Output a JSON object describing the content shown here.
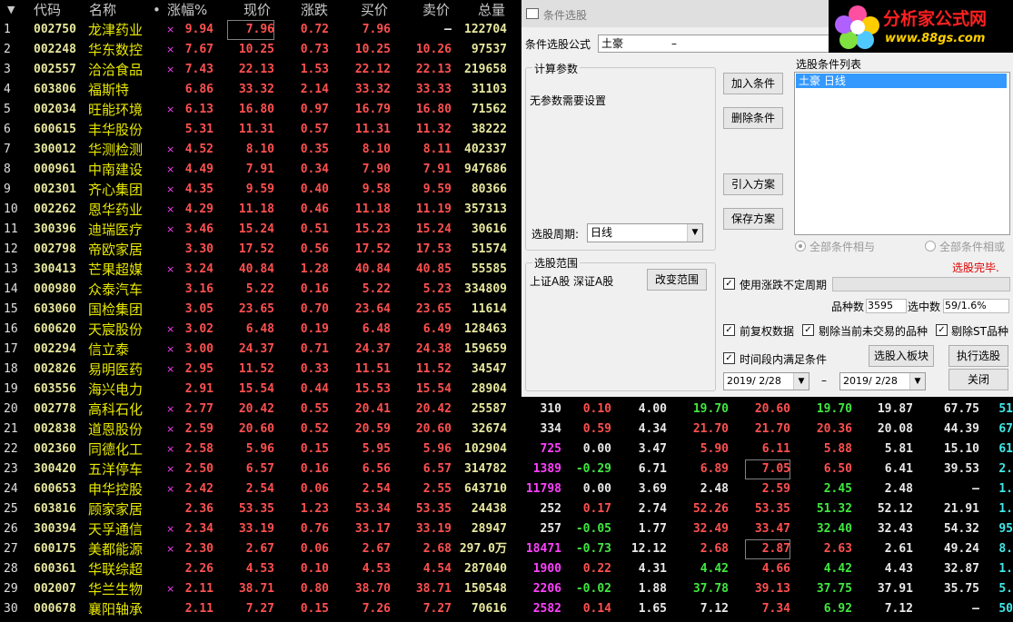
{
  "header": {
    "code": "代码",
    "name": "名称",
    "dot": "•",
    "pct": "涨幅%",
    "price": "现价",
    "chg": "涨跌",
    "bid": "买价",
    "ask": "卖价",
    "vol": "总量",
    "sort_arrow": "▼"
  },
  "rows": [
    {
      "idx": "1",
      "code": "002750",
      "name": "龙津药业",
      "star": "×",
      "pct": "9.94",
      "price": "7.96",
      "chg": "0.72",
      "bid": "7.96",
      "ask": "–",
      "vol": "122704"
    },
    {
      "idx": "2",
      "code": "002248",
      "name": "华东数控",
      "star": "×",
      "pct": "7.67",
      "price": "10.25",
      "chg": "0.73",
      "bid": "10.25",
      "ask": "10.26",
      "vol": "97537"
    },
    {
      "idx": "3",
      "code": "002557",
      "name": "洽洽食品",
      "star": "×",
      "pct": "7.43",
      "price": "22.13",
      "chg": "1.53",
      "bid": "22.12",
      "ask": "22.13",
      "vol": "219658"
    },
    {
      "idx": "4",
      "code": "603806",
      "name": "福斯特",
      "star": "",
      "pct": "6.86",
      "price": "33.32",
      "chg": "2.14",
      "bid": "33.32",
      "ask": "33.33",
      "vol": "31103"
    },
    {
      "idx": "5",
      "code": "002034",
      "name": "旺能环境",
      "star": "×",
      "pct": "6.13",
      "price": "16.80",
      "chg": "0.97",
      "bid": "16.79",
      "ask": "16.80",
      "vol": "71562"
    },
    {
      "idx": "6",
      "code": "600615",
      "name": "丰华股份",
      "star": "",
      "pct": "5.31",
      "price": "11.31",
      "chg": "0.57",
      "bid": "11.31",
      "ask": "11.32",
      "vol": "38222"
    },
    {
      "idx": "7",
      "code": "300012",
      "name": "华测检测",
      "star": "×",
      "pct": "4.52",
      "price": "8.10",
      "chg": "0.35",
      "bid": "8.10",
      "ask": "8.11",
      "vol": "402337"
    },
    {
      "idx": "8",
      "code": "000961",
      "name": "中南建设",
      "star": "×",
      "pct": "4.49",
      "price": "7.91",
      "chg": "0.34",
      "bid": "7.90",
      "ask": "7.91",
      "vol": "947686"
    },
    {
      "idx": "9",
      "code": "002301",
      "name": "齐心集团",
      "star": "×",
      "pct": "4.35",
      "price": "9.59",
      "chg": "0.40",
      "bid": "9.58",
      "ask": "9.59",
      "vol": "80366"
    },
    {
      "idx": "10",
      "code": "002262",
      "name": "恩华药业",
      "star": "×",
      "pct": "4.29",
      "price": "11.18",
      "chg": "0.46",
      "bid": "11.18",
      "ask": "11.19",
      "vol": "357313"
    },
    {
      "idx": "11",
      "code": "300396",
      "name": "迪瑞医疗",
      "star": "×",
      "pct": "3.46",
      "price": "15.24",
      "chg": "0.51",
      "bid": "15.23",
      "ask": "15.24",
      "vol": "30616"
    },
    {
      "idx": "12",
      "code": "002798",
      "name": "帝欧家居",
      "star": "",
      "pct": "3.30",
      "price": "17.52",
      "chg": "0.56",
      "bid": "17.52",
      "ask": "17.53",
      "vol": "51574"
    },
    {
      "idx": "13",
      "code": "300413",
      "name": "芒果超媒",
      "star": "×",
      "pct": "3.24",
      "price": "40.84",
      "chg": "1.28",
      "bid": "40.84",
      "ask": "40.85",
      "vol": "55585"
    },
    {
      "idx": "14",
      "code": "000980",
      "name": "众泰汽车",
      "star": "",
      "pct": "3.16",
      "price": "5.22",
      "chg": "0.16",
      "bid": "5.22",
      "ask": "5.23",
      "vol": "334809"
    },
    {
      "idx": "15",
      "code": "603060",
      "name": "国检集团",
      "star": "",
      "pct": "3.05",
      "price": "23.65",
      "chg": "0.70",
      "bid": "23.64",
      "ask": "23.65",
      "vol": "11614"
    },
    {
      "idx": "16",
      "code": "600620",
      "name": "天宸股份",
      "star": "×",
      "pct": "3.02",
      "price": "6.48",
      "chg": "0.19",
      "bid": "6.48",
      "ask": "6.49",
      "vol": "128463"
    },
    {
      "idx": "17",
      "code": "002294",
      "name": "信立泰",
      "star": "×",
      "pct": "3.00",
      "price": "24.37",
      "chg": "0.71",
      "bid": "24.37",
      "ask": "24.38",
      "vol": "159659"
    },
    {
      "idx": "18",
      "code": "002826",
      "name": "易明医药",
      "star": "×",
      "pct": "2.95",
      "price": "11.52",
      "chg": "0.33",
      "bid": "11.51",
      "ask": "11.52",
      "vol": "34547"
    },
    {
      "idx": "19",
      "code": "603556",
      "name": "海兴电力",
      "star": "",
      "pct": "2.91",
      "price": "15.54",
      "chg": "0.44",
      "bid": "15.53",
      "ask": "15.54",
      "vol": "28904"
    },
    {
      "idx": "20",
      "code": "002778",
      "name": "高科石化",
      "star": "×",
      "pct": "2.77",
      "price": "20.42",
      "chg": "0.55",
      "bid": "20.41",
      "ask": "20.42",
      "vol": "25587",
      "x": [
        "310",
        "0.10",
        "4.00",
        "19.70",
        "20.60",
        "19.70",
        "19.87",
        "67.75",
        "51"
      ]
    },
    {
      "idx": "21",
      "code": "002838",
      "name": "道恩股份",
      "star": "×",
      "pct": "2.59",
      "price": "20.60",
      "chg": "0.52",
      "bid": "20.59",
      "ask": "20.60",
      "vol": "32674",
      "x": [
        "334",
        "0.59",
        "4.34",
        "21.70",
        "21.70",
        "20.36",
        "20.08",
        "44.39",
        "67"
      ]
    },
    {
      "idx": "22",
      "code": "002360",
      "name": "同德化工",
      "star": "×",
      "pct": "2.58",
      "price": "5.96",
      "chg": "0.15",
      "bid": "5.95",
      "ask": "5.96",
      "vol": "102904",
      "x": [
        "725",
        "0.00",
        "3.47",
        "5.90",
        "6.11",
        "5.88",
        "5.81",
        "15.10",
        "61"
      ]
    },
    {
      "idx": "23",
      "code": "300420",
      "name": "五洋停车",
      "star": "×",
      "pct": "2.50",
      "price": "6.57",
      "chg": "0.16",
      "bid": "6.56",
      "ask": "6.57",
      "vol": "314782",
      "x": [
        "1389",
        "-0.29",
        "6.71",
        "6.89",
        "7.05",
        "6.50",
        "6.41",
        "39.53",
        "2."
      ]
    },
    {
      "idx": "24",
      "code": "600653",
      "name": "申华控股",
      "star": "×",
      "pct": "2.42",
      "price": "2.54",
      "chg": "0.06",
      "bid": "2.54",
      "ask": "2.55",
      "vol": "643710",
      "x": [
        "11798",
        "0.00",
        "3.69",
        "2.48",
        "2.59",
        "2.45",
        "2.48",
        "–",
        "1."
      ]
    },
    {
      "idx": "25",
      "code": "603816",
      "name": "顾家家居",
      "star": "",
      "pct": "2.36",
      "price": "53.35",
      "chg": "1.23",
      "bid": "53.34",
      "ask": "53.35",
      "vol": "24438",
      "x": [
        "252",
        "0.17",
        "2.74",
        "52.26",
        "53.35",
        "51.32",
        "52.12",
        "21.91",
        "1."
      ]
    },
    {
      "idx": "26",
      "code": "300394",
      "name": "天孚通信",
      "star": "×",
      "pct": "2.34",
      "price": "33.19",
      "chg": "0.76",
      "bid": "33.17",
      "ask": "33.19",
      "vol": "28947",
      "x": [
        "257",
        "-0.05",
        "1.77",
        "32.49",
        "33.47",
        "32.40",
        "32.43",
        "54.32",
        "95"
      ]
    },
    {
      "idx": "27",
      "code": "600175",
      "name": "美都能源",
      "star": "×",
      "pct": "2.30",
      "price": "2.67",
      "chg": "0.06",
      "bid": "2.67",
      "ask": "2.68",
      "vol": "297.0万",
      "x": [
        "18471",
        "-0.73",
        "12.12",
        "2.68",
        "2.87",
        "2.63",
        "2.61",
        "49.24",
        "8."
      ]
    },
    {
      "idx": "28",
      "code": "600361",
      "name": "华联综超",
      "star": "",
      "pct": "2.26",
      "price": "4.53",
      "chg": "0.10",
      "bid": "4.53",
      "ask": "4.54",
      "vol": "287040",
      "x": [
        "1900",
        "0.22",
        "4.31",
        "4.42",
        "4.66",
        "4.42",
        "4.43",
        "32.87",
        "1."
      ]
    },
    {
      "idx": "29",
      "code": "002007",
      "name": "华兰生物",
      "star": "×",
      "pct": "2.11",
      "price": "38.71",
      "chg": "0.80",
      "bid": "38.70",
      "ask": "38.71",
      "vol": "150548",
      "x": [
        "2206",
        "-0.02",
        "1.88",
        "37.78",
        "39.13",
        "37.75",
        "37.91",
        "35.75",
        "5."
      ]
    },
    {
      "idx": "30",
      "code": "000678",
      "name": "襄阳轴承",
      "star": "",
      "pct": "2.11",
      "price": "7.27",
      "chg": "0.15",
      "bid": "7.26",
      "ask": "7.27",
      "vol": "70616",
      "x": [
        "2582",
        "0.14",
        "1.65",
        "7.12",
        "7.34",
        "6.92",
        "7.12",
        "–",
        "50"
      ]
    }
  ],
  "dialog": {
    "title": "条件选股",
    "formula_label": "条件选股公式",
    "formula_value": "土豪",
    "formula_dash": "–",
    "params_group": "计算参数",
    "no_params": "无参数需要设置",
    "period_label": "选股周期:",
    "period_value": "日线",
    "scope_group": "选股范围",
    "scope_value": "上证A股  深证A股",
    "change_scope": "改变范围",
    "btn_add": "加入条件",
    "btn_delete": "删除条件",
    "btn_import": "引入方案",
    "btn_save": "保存方案",
    "list_label": "选股条件列表",
    "list_items": [
      "土豪  日线"
    ],
    "radio_and": "全部条件相与",
    "radio_or": "全部条件相或",
    "status": "选股完毕.",
    "use_period": "使用涨跌不定周期",
    "count_label": "品种数",
    "count_value": "3595",
    "chosen_label": "选中数",
    "chosen_value": "59/1.6%",
    "adj": "前复权数据",
    "excl_untraded": "剔除当前未交易的品种",
    "excl_st": "剔除ST品种",
    "time_range": "时间段内满足条件",
    "btn_to_block": "选股入板块",
    "btn_run": "执行选股",
    "date_from": "2019/ 2/28",
    "date_sep": "–",
    "date_to": "2019/ 2/28",
    "btn_close": "关闭"
  },
  "logo": {
    "text": "分析家公式网",
    "url": "www.88gs.com"
  },
  "colors": {
    "up": "#ff5050",
    "down": "#40e840",
    "name": "#e8e800",
    "magenta": "#ff40ff",
    "dialog_bg": "#f0f0f0",
    "selection": "#3399ff"
  }
}
